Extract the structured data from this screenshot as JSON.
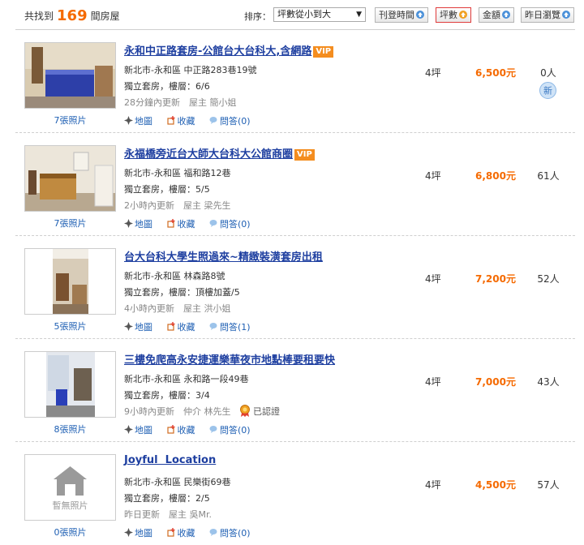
{
  "summary": {
    "prefix": "共找到",
    "count": "169",
    "suffix": "間房屋"
  },
  "sort": {
    "label": "排序：",
    "selected": "坪數從小到大",
    "buttons": [
      {
        "label": "刊登時間"
      },
      {
        "label": "坪數"
      },
      {
        "label": "金額"
      },
      {
        "label": "昨日瀏覽"
      }
    ]
  },
  "actions_labels": {
    "map": "地圖",
    "fav": "收藏"
  },
  "listings": [
    {
      "title": "永和中正路套房-公館台大台科大,含網路",
      "vip": "VIP",
      "address": "新北市-永和區 中正路283巷19號",
      "type": "獨立套房，樓層：6/6",
      "meta": "28分鐘內更新　屋主 簡小姐",
      "photos": "7張照片",
      "qa": "問答(0)",
      "size": "4坪",
      "price": "6,500元",
      "views": "0人",
      "badge": "新"
    },
    {
      "title": "永福橋旁近台大師大台科大公館商圈",
      "vip": "VIP",
      "address": "新北市-永和區 福和路12巷",
      "type": "獨立套房，樓層：5/5",
      "meta": "2小時內更新　屋主 梁先生",
      "photos": "7張照片",
      "qa": "問答(0)",
      "size": "4坪",
      "price": "6,800元",
      "views": "61人"
    },
    {
      "title": "台大台科大學生照過來~精緻裝潢套房出租",
      "address": "新北市-永和區 林森路8號",
      "type": "獨立套房，樓層：頂樓加蓋/5",
      "meta": "4小時內更新　屋主 洪小姐",
      "photos": "5張照片",
      "qa": "問答(1)",
      "size": "4坪",
      "price": "7,200元",
      "views": "52人"
    },
    {
      "title": "三樓免爬高永安捷運樂華夜市地點棒要租要快",
      "address": "新北市-永和區 永和路一段49巷",
      "type": "獨立套房，樓層：3/4",
      "meta": "9小時內更新　仲介 林先生",
      "cert": "已認證",
      "photos": "8張照片",
      "qa": "問答(0)",
      "size": "4坪",
      "price": "7,000元",
      "views": "43人"
    },
    {
      "title": "Joyful  Location",
      "address": "新北市-永和區 民樂街69巷",
      "type": "獨立套房，樓層：2/5",
      "meta": "昨日更新　屋主 吳Mr.",
      "photos": "0張照片",
      "no_photo": "暫無照片",
      "qa": "問答(0)",
      "size": "4坪",
      "price": "4,500元",
      "views": "57人"
    }
  ],
  "colors": {
    "accent": "#f56a00",
    "link": "#1e3fa0",
    "vip": "#f48d1f"
  }
}
